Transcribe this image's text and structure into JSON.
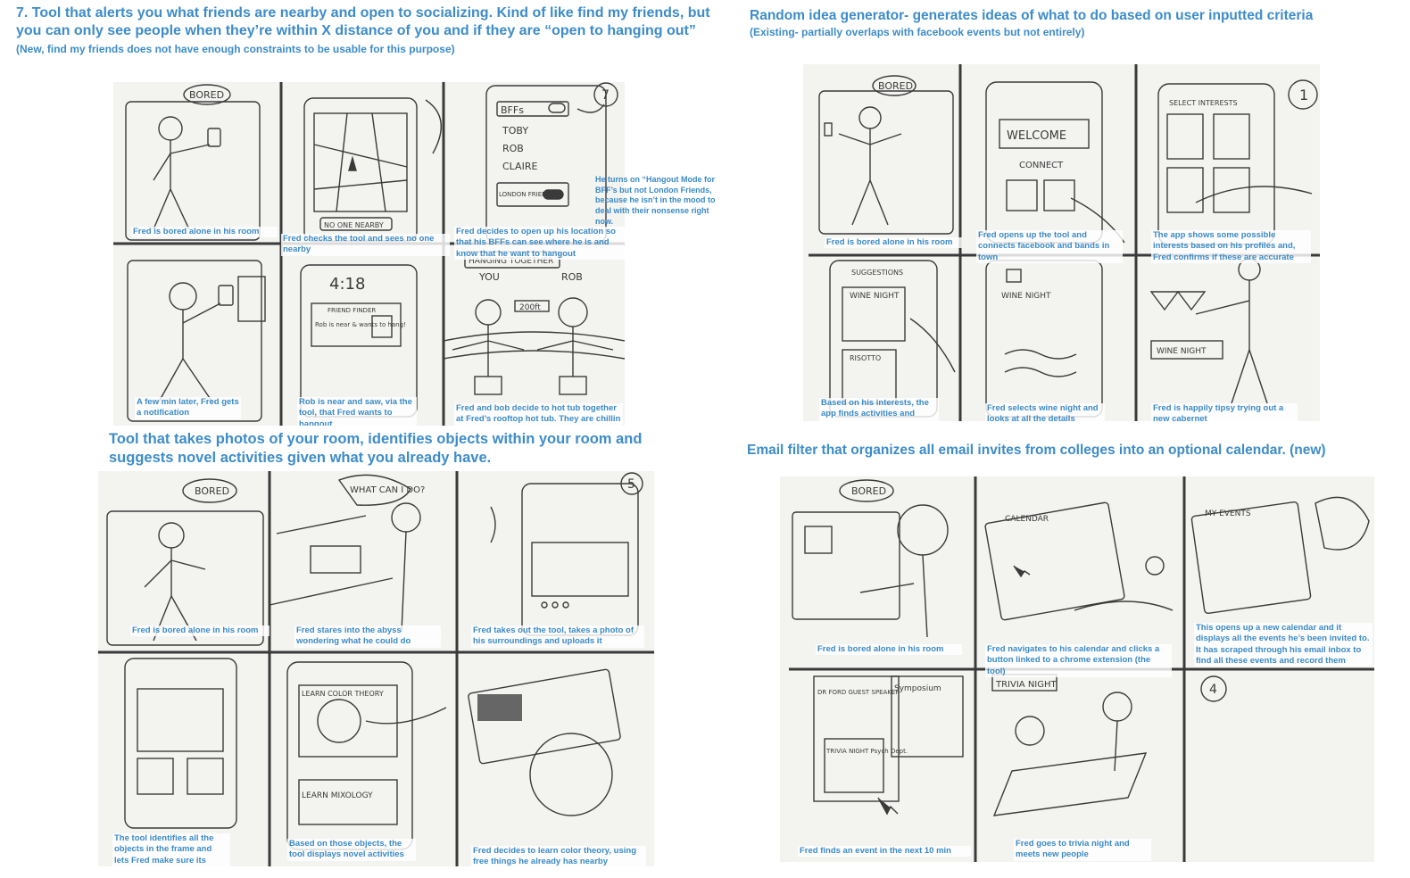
{
  "sections": {
    "s1": {
      "title": "7. Tool that alerts you what friends are nearby and open to socializing. Kind of like find my friends, but you can only see people when they’re within X distance of you and if they are “open to hanging out”",
      "subtitle": "(New, find my friends does not have enough constraints to be usable for this purpose)",
      "number_label": "7",
      "side_note": "He turns on “Hangout Mode for BFF’s but not London Friends, because he isn’t in the mood to deal with their nonsense  right now.",
      "captions": [
        "Fred is bored alone in his room",
        "Fred checks the tool and sees no one nearby",
        "Fred decides to open up his location so that his BFFs can see where he is and know that he want to hangout",
        "A few min later, Fred gets a notification",
        "Rob is near and saw, via the tool, that Fred wants to hangout",
        "Fred and bob decide to hot tub  together at Fred’s rooftop hot tub. They are chillin"
      ],
      "sketch_text": {
        "bored": "BORED",
        "bffs": "BFFs",
        "toby": "TOBY",
        "rob": "ROB",
        "claire": "CLAIRE",
        "london": "LONDON FRIENDS",
        "no_one": "NO ONE NEARBY",
        "time": "4:18",
        "friend_finder": "FRIEND FINDER",
        "rob_near": "Rob is near & wants to hang!",
        "hanging": "HANGING TOGETHER",
        "you": "YOU",
        "rob2": "ROB",
        "dist": "200ft"
      }
    },
    "s2": {
      "title": "Random idea generator- generates ideas of what to do based on user inputted criteria",
      "subtitle": "(Existing- partially overlaps with facebook events but not entirely)",
      "number_label": "1",
      "captions": [
        "Fred is bored alone in his room",
        "Fred opens up the tool and connects facebook and bands in town",
        "The app shows some possible interests based on his profiles and, Fred confirms if these are accurate",
        "Based on his interests, the app finds activities and displays relevant information",
        "Fred selects wine night and looks at all the details",
        "Fred is happily tipsy trying out a new cabernet"
      ],
      "sketch_text": {
        "bored": "BORED",
        "welcome": "WELCOME",
        "connect": "CONNECT",
        "select": "SELECT INTERESTS",
        "suggestions": "SUGGESTIONS",
        "wine_night": "WINE NIGHT",
        "risotto": "RISOTTO",
        "wine_night2": "WINE NIGHT",
        "wine_night3": "WINE NIGHT"
      }
    },
    "s3": {
      "title": "Tool that takes photos of your room, identifies objects within your room and suggests novel activities given what you already have.",
      "number_label": "5",
      "captions": [
        "Fred is bored alone in his room",
        "Fred stares into the abyss wondering what he could do",
        "Fred takes out the tool, takes a photo of his surroundings  and uploads it",
        "The tool identifies all the objects in the frame and lets Fred make sure its accurate",
        "Based on those objects, the tool displays novel activities",
        "Fred decides to learn color theory, using free things he already has nearby"
      ],
      "sketch_text": {
        "bored": "BORED",
        "what": "WHAT CAN I DO?",
        "learn_color": "LEARN COLOR THEORY",
        "learn_mix": "LEARN MIXOLOGY"
      }
    },
    "s4": {
      "title": "Email filter that organizes all email invites from colleges into an optional calendar. (new)",
      "number_label": "4",
      "captions": [
        "Fred is bored alone in his room",
        "Fred navigates to his calendar and clicks a button linked to a chrome extension (the tool)",
        "This opens up a new calendar and it displays all the events he’s been invited to. It has scraped through his email inbox to find all these events and record them",
        "Fred finds an event in the next 10 min",
        "Fred goes to trivia night and meets new people"
      ],
      "sketch_text": {
        "bored": "BORED",
        "calendar": "CALENDAR",
        "my_events": "MY EVENTS",
        "dr_ford": "DR FORD GUEST SPEAKER",
        "symposium": "Symposium",
        "trivia": "TRIVIA NIGHT Psych Dept.",
        "trivia_night": "TRIVIA NIGHT"
      }
    }
  },
  "colors": {
    "accent": "#3d8cc9",
    "paper": "#f3f3f0",
    "ink": "#3a3a3a"
  }
}
